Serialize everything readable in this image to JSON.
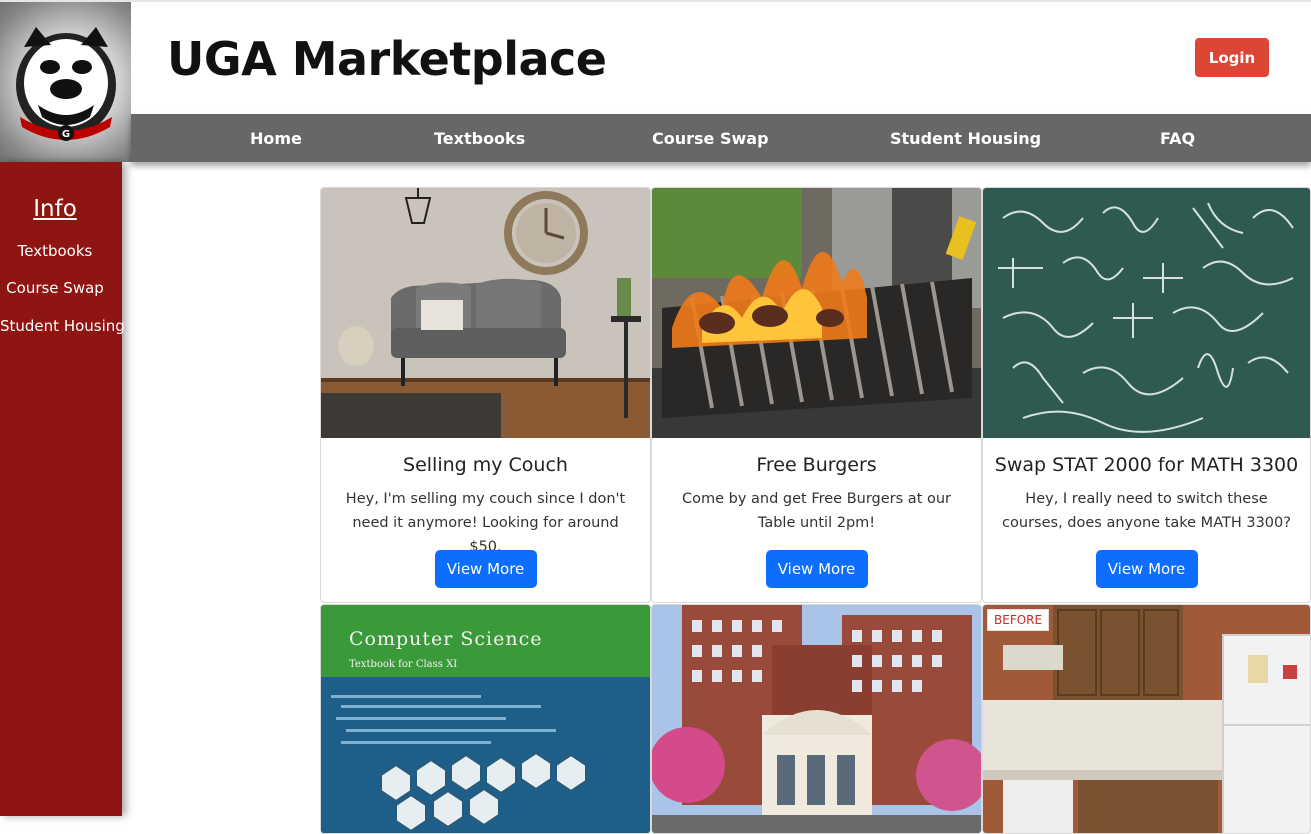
{
  "header": {
    "title": "UGA Marketplace",
    "login_label": "Login",
    "logo_icon": "bulldog-logo-icon"
  },
  "nav": {
    "items": [
      {
        "label": "Home"
      },
      {
        "label": "Textbooks"
      },
      {
        "label": "Course Swap"
      },
      {
        "label": "Student Housing"
      },
      {
        "label": "FAQ"
      }
    ]
  },
  "sidebar": {
    "heading": "Info",
    "items": [
      {
        "label": "Textbooks"
      },
      {
        "label": "Course Swap"
      },
      {
        "label": "Student Housing"
      }
    ]
  },
  "cards": [
    {
      "title": "Selling my Couch",
      "text": "Hey, I'm selling my couch since I don't need it anymore! Looking for around $50.",
      "button": "View More",
      "image_icon": "couch-photo-icon"
    },
    {
      "title": "Free Burgers",
      "text": "Come by and get Free Burgers at our Table until 2pm!",
      "button": "View More",
      "image_icon": "grill-photo-icon"
    },
    {
      "title": "Swap STAT 2000 for MATH 3300",
      "text": "Hey, I really need to switch these courses, does anyone take MATH 3300?",
      "button": "View More",
      "image_icon": "chalkboard-photo-icon"
    },
    {
      "image_icon": "textbook-photo-icon",
      "image_text": {
        "title": "Computer Science",
        "subtitle": "Textbook for Class XI"
      }
    },
    {
      "image_icon": "dorm-building-photo-icon"
    },
    {
      "image_icon": "kitchen-photo-icon",
      "image_text": {
        "tag": "BEFORE"
      }
    }
  ],
  "colors": {
    "sidebar": "#8f1513",
    "navbar": "#676767",
    "login": "#dc4637",
    "button": "#0d6efd"
  }
}
